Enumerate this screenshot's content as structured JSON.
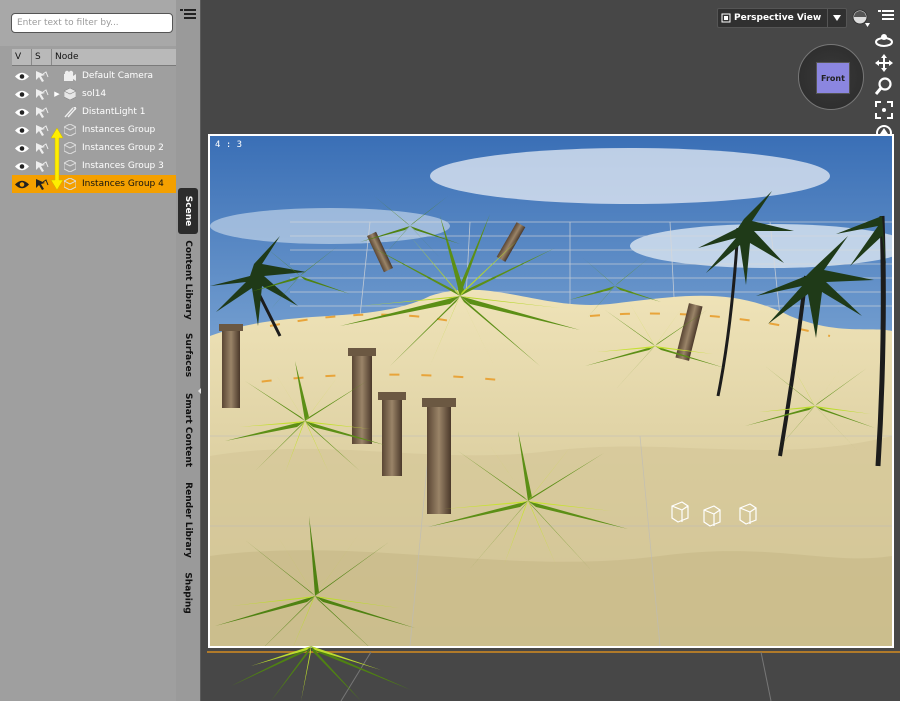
{
  "scene_panel": {
    "filter": {
      "placeholder": "Enter text to filter by..."
    },
    "columns": {
      "v": "V",
      "s": "S",
      "node": "Node"
    },
    "nodes": [
      {
        "label": "Default Camera",
        "icon": "camera-icon",
        "expandable": false,
        "selected": false
      },
      {
        "label": "sol14",
        "icon": "cube-icon",
        "expandable": true,
        "selected": false
      },
      {
        "label": "DistantLight 1",
        "icon": "light-icon",
        "expandable": false,
        "selected": false
      },
      {
        "label": "Instances Group",
        "icon": "group-icon",
        "expandable": false,
        "selected": false
      },
      {
        "label": "Instances Group 2",
        "icon": "group-icon",
        "expandable": false,
        "selected": false
      },
      {
        "label": "Instances Group 3",
        "icon": "group-icon",
        "expandable": false,
        "selected": false
      },
      {
        "label": "Instances Group 4",
        "icon": "group-icon",
        "expandable": false,
        "selected": true
      }
    ]
  },
  "side_tabs": {
    "scene": "Scene",
    "content_library": "Content Library",
    "surfaces": "Surfaces",
    "smart_content": "Smart Content",
    "render_library": "Render Library",
    "shaping": "Shaping"
  },
  "viewport": {
    "view_label": "Perspective View",
    "aspect_label": "4 : 3",
    "cube_face": "Front"
  },
  "colors": {
    "selection": "#f4a000",
    "panel": "#9f9f9f",
    "viewport": "#474747"
  }
}
